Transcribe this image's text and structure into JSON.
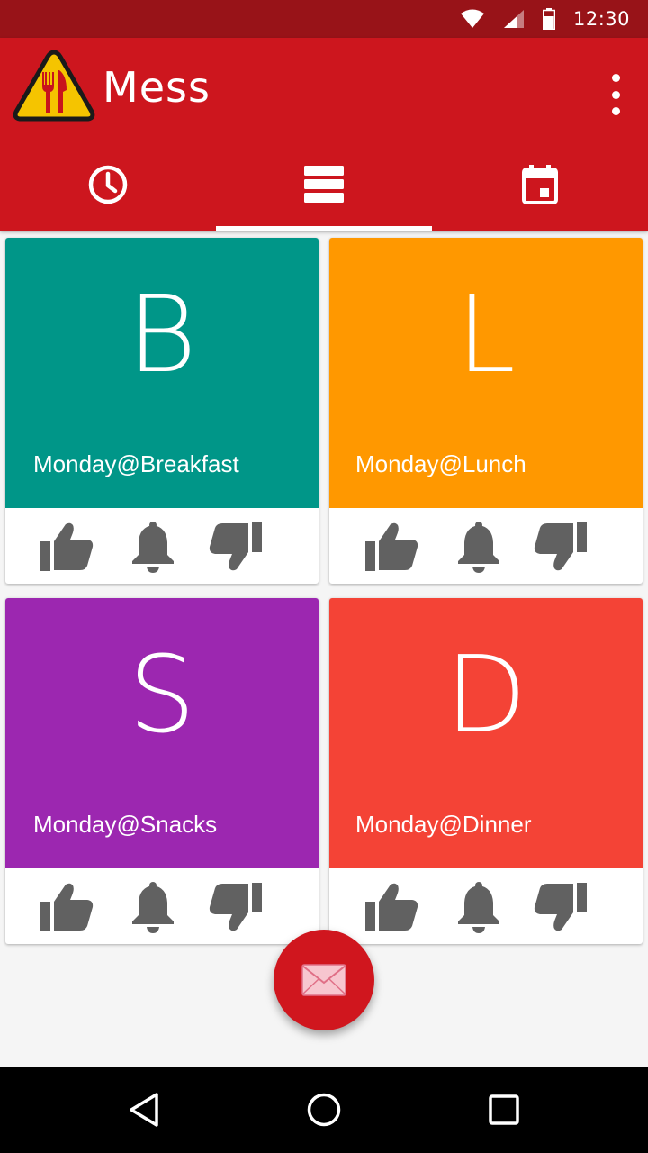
{
  "status_bar": {
    "time": "12:30",
    "icons": [
      "wifi-icon",
      "cell-signal-icon",
      "battery-icon"
    ]
  },
  "app_bar": {
    "title": "Mess",
    "logo_icon": "fork-knife-warning-icon",
    "overflow_icon": "more-vert-icon"
  },
  "tabs": [
    {
      "icon": "clock-icon",
      "active": false
    },
    {
      "icon": "list-icon",
      "active": true
    },
    {
      "icon": "calendar-icon",
      "active": false
    }
  ],
  "meals": [
    {
      "letter": "B",
      "label": "Monday@Breakfast",
      "color": "#009688"
    },
    {
      "letter": "L",
      "label": "Monday@Lunch",
      "color": "#ff9800"
    },
    {
      "letter": "S",
      "label": "Monday@Snacks",
      "color": "#9c27b0"
    },
    {
      "letter": "D",
      "label": "Monday@Dinner",
      "color": "#f44336"
    }
  ],
  "card_actions": [
    "thumbs-up-icon",
    "bell-icon",
    "thumbs-down-icon"
  ],
  "fab": {
    "icon": "mail-icon",
    "color": "#d0161e"
  },
  "nav_bar": [
    "back-icon",
    "home-icon",
    "recents-icon"
  ],
  "colors": {
    "primary": "#cd161e",
    "primary_dark": "#981318",
    "icon_gray": "#616161"
  }
}
